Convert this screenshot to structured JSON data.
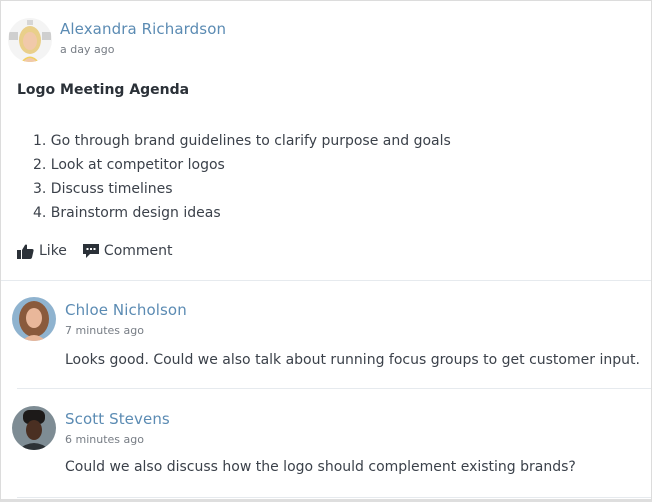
{
  "post": {
    "author": "Alexandra Richardson",
    "timestamp": "a day ago",
    "title": "Logo Meeting Agenda",
    "agenda": [
      "1. Go through brand guidelines to clarify purpose and goals",
      "2. Look at competitor logos",
      "3. Discuss timelines",
      "4. Brainstorm design ideas"
    ],
    "actions": {
      "like_label": "Like",
      "like_icon": "thumbs-up-icon",
      "comment_label": "Comment",
      "comment_icon": "comment-icon"
    }
  },
  "comments": [
    {
      "author": "Chloe Nicholson",
      "timestamp": "7 minutes ago",
      "text": "Looks good. Could we also talk about running focus groups to get customer input."
    },
    {
      "author": "Scott Stevens",
      "timestamp": "6 minutes ago",
      "text": "Could we also discuss how the logo should complement existing brands?"
    }
  ],
  "colors": {
    "author_name": "#5b8bb3",
    "text": "#3b414a",
    "muted": "#777d85",
    "divider": "#e6eaee"
  }
}
